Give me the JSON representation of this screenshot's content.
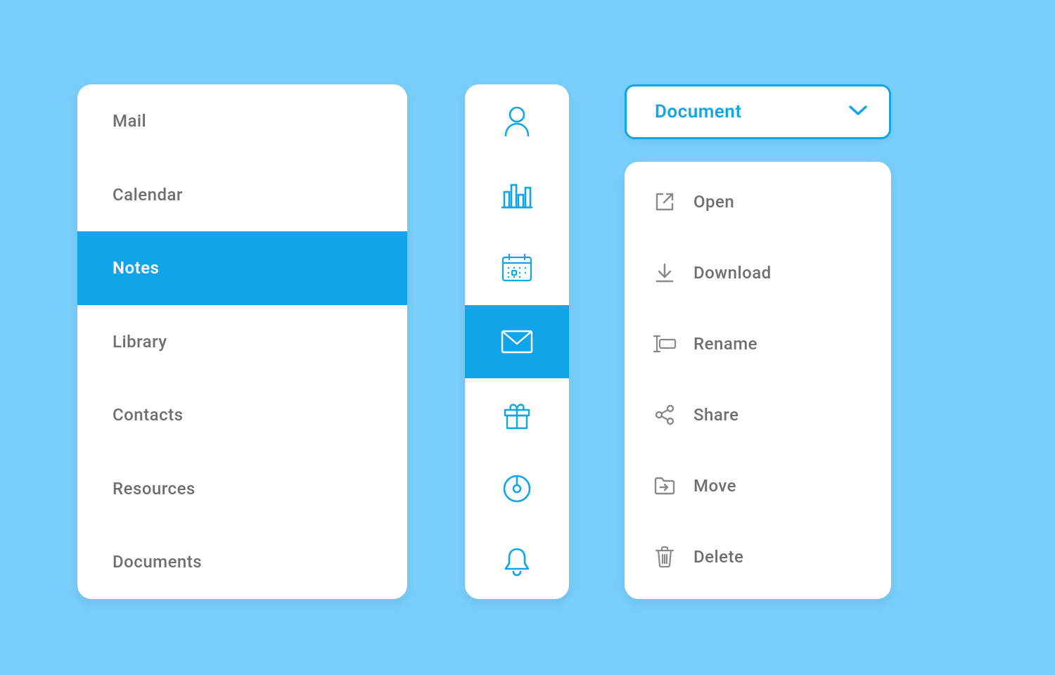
{
  "colors": {
    "background": "#79cffb",
    "accent": "#10a5e9",
    "text_muted": "#6f6f6f",
    "text_icon": "#8a8a8a",
    "white": "#ffffff"
  },
  "nav": {
    "selected_index": 2,
    "items": [
      {
        "label": "Mail"
      },
      {
        "label": "Calendar"
      },
      {
        "label": "Notes"
      },
      {
        "label": "Library"
      },
      {
        "label": "Contacts"
      },
      {
        "label": "Resources"
      },
      {
        "label": "Documents"
      }
    ]
  },
  "icon_rail": {
    "selected_index": 3,
    "items": [
      {
        "icon": "user-icon"
      },
      {
        "icon": "bar-chart-icon"
      },
      {
        "icon": "calendar-grid-icon"
      },
      {
        "icon": "mail-icon"
      },
      {
        "icon": "gift-icon"
      },
      {
        "icon": "disc-icon"
      },
      {
        "icon": "bell-icon"
      }
    ]
  },
  "dropdown": {
    "label": "Document"
  },
  "context_menu": {
    "items": [
      {
        "label": "Open",
        "icon": "external-link-icon"
      },
      {
        "label": "Download",
        "icon": "download-icon"
      },
      {
        "label": "Rename",
        "icon": "rename-icon"
      },
      {
        "label": "Share",
        "icon": "share-nodes-icon"
      },
      {
        "label": "Move",
        "icon": "folder-move-icon"
      },
      {
        "label": "Delete",
        "icon": "trash-icon"
      }
    ]
  }
}
